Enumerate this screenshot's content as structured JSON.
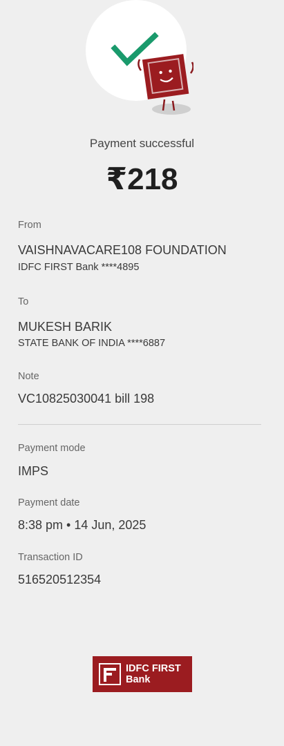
{
  "status": {
    "message": "Payment successful",
    "amount": "₹218"
  },
  "from": {
    "label": "From",
    "name": "VAISHNAVACARE108 FOUNDATION",
    "account": "IDFC FIRST Bank ****4895"
  },
  "to": {
    "label": "To",
    "name": "MUKESH BARIK",
    "account": "STATE BANK OF INDIA ****6887"
  },
  "note": {
    "label": "Note",
    "value": "VC10825030041 bill 198"
  },
  "payment_mode": {
    "label": "Payment mode",
    "value": "IMPS"
  },
  "payment_date": {
    "label": "Payment date",
    "value": "8:38 pm • 14 Jun, 2025"
  },
  "transaction": {
    "label": "Transaction ID",
    "value": "516520512354"
  },
  "brand": {
    "line1": "IDFC FIRST",
    "line2": "Bank",
    "color": "#9b1c20",
    "check_color": "#1a9a6c"
  },
  "icons": [
    "success-check-icon",
    "bank-mascot-icon",
    "idfc-logo-icon"
  ]
}
